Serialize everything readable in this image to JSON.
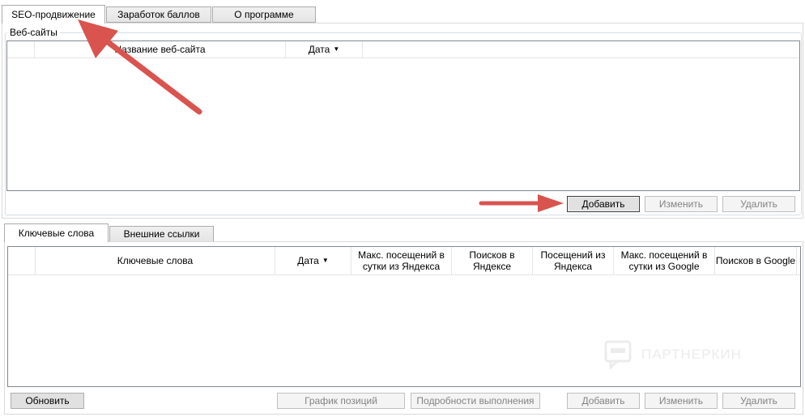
{
  "top_tabs": [
    "SEO-продвижение",
    "Заработок баллов",
    "О программе"
  ],
  "websites": {
    "legend": "Веб-сайты",
    "columns": [
      "Название веб-сайта",
      "Дата"
    ],
    "sort_icon": "sort-descending-icon",
    "buttons": {
      "add": "Добавить",
      "edit": "Изменить",
      "delete": "Удалить"
    }
  },
  "sub_tabs": [
    "Ключевые слова",
    "Внешние ссылки"
  ],
  "keywords": {
    "columns": [
      "Ключевые слова",
      "Дата",
      "Макс. посещений в сутки из Яндекса",
      "Поисков в Яндексе",
      "Посещений из Яндекса",
      "Макс. посещений в сутки из Google",
      "Поисков в Google"
    ]
  },
  "bottom_buttons": {
    "refresh": "Обновить",
    "chart": "График позиций",
    "details": "Подробности выполнения",
    "add": "Добавить",
    "edit": "Изменить",
    "delete": "Удалить"
  },
  "watermark": "ПАРТНЕРКИН",
  "annotation_color": "#d9534f"
}
